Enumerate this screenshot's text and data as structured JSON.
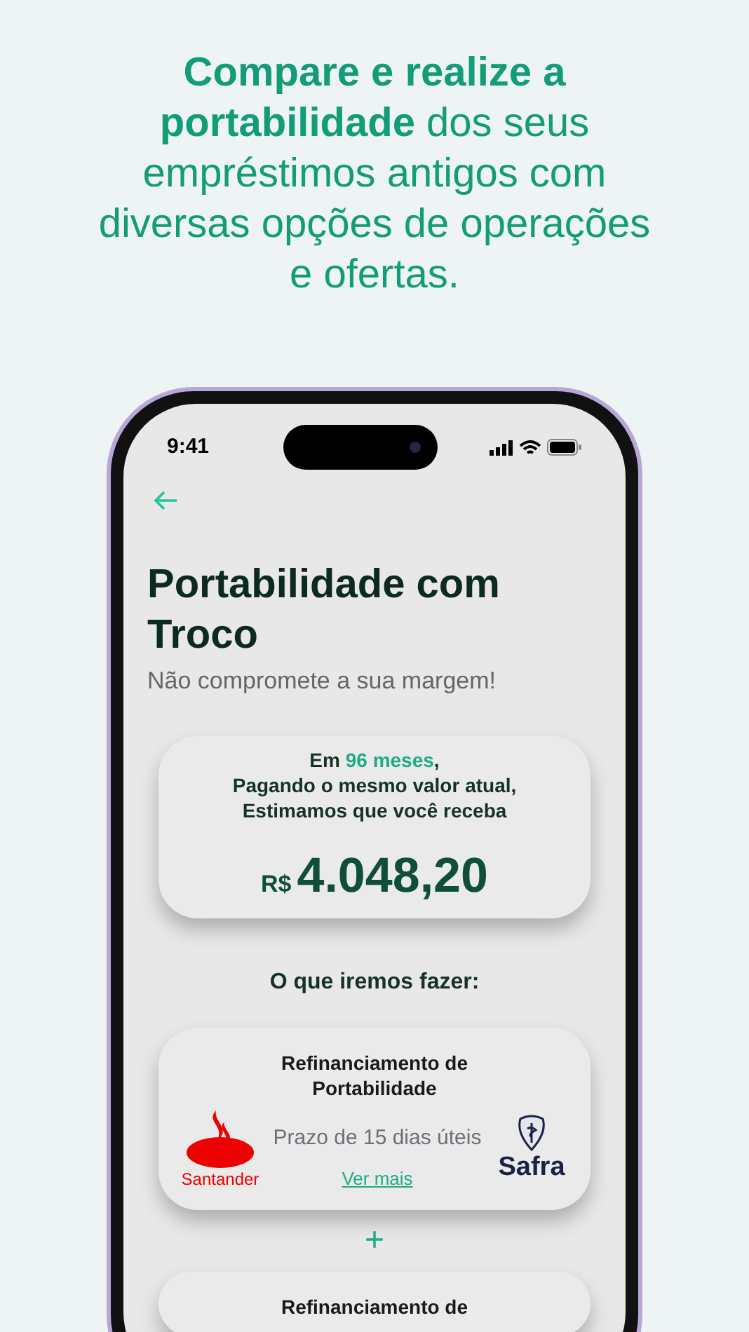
{
  "headline": "**Compare e realize a portabilidade** dos seus empréstimos antigos com diversas opções de operações e ofertas.",
  "phone": {
    "status_bar": {
      "time": "9:41"
    },
    "title": "Portabilidade com Troco",
    "subtitle": "Não compromete a sua margem!",
    "estimate": {
      "prefix": "Em",
      "term": "96 meses",
      "suffix": ",",
      "lines": [
        "Pagando o mesmo valor atual,",
        "Estimamos que você receba"
      ],
      "currency": "R$",
      "amount": "4.048,20"
    },
    "section_title": "O que iremos fazer:",
    "steps": [
      {
        "title": "Refinanciamento de Portabilidade",
        "from_bank": "Santander",
        "deadline": "Prazo de 15 dias úteis",
        "link": "Ver mais",
        "to_bank": "Safra"
      },
      {
        "title": "Refinanciamento de"
      }
    ],
    "connector": "+"
  }
}
